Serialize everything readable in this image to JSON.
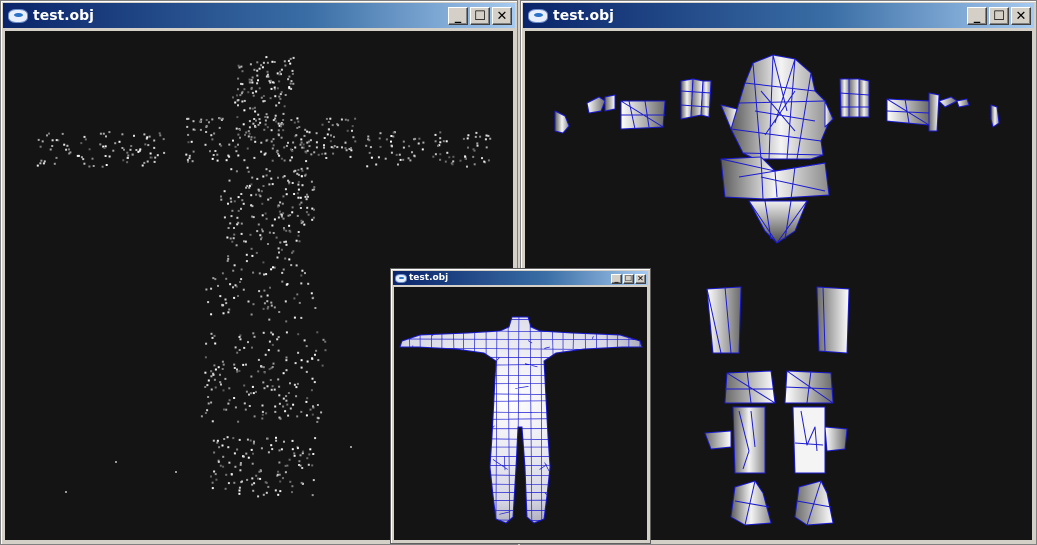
{
  "windows": [
    {
      "title": "test.obj",
      "view": "vertex-point-cloud"
    },
    {
      "title": "test.obj",
      "view": "uv-texture-layout"
    },
    {
      "title": "test.obj",
      "view": "3d-wireframe-model"
    }
  ],
  "controls": {
    "minimize_icon": "minimize-icon",
    "maximize_icon": "maximize-icon",
    "close_icon": "close-icon"
  },
  "colors": {
    "viewport_background": "#141414",
    "wire": "#1a1ad0",
    "titlebar_start": "#0a246a",
    "titlebar_end": "#a6caf0",
    "window_frame": "#d4d0c8"
  }
}
